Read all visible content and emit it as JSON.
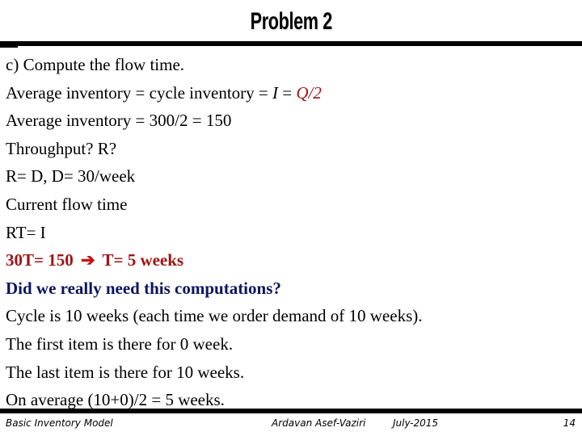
{
  "slide": {
    "title": "Problem 2",
    "lines": [
      {
        "text": "c) Compute the flow time."
      },
      {
        "prefix": "Average inventory = cycle inventory =  ",
        "var": "I",
        "eq": " = ",
        "formula": "Q/2"
      },
      {
        "text": "Average inventory  = 300/2 = 150"
      },
      {
        "text": "Throughput?  R?"
      },
      {
        "text": "R= D,  D= 30/week"
      },
      {
        "text": "Current flow time"
      },
      {
        "text": "RT= I"
      },
      {
        "left": "30T= 150",
        "arrow_icon": "right-arrow-icon",
        "arrow_glyph": "➔",
        "right": "T= 5 weeks"
      },
      {
        "text": "Did we really need this computations?"
      },
      {
        "text": "Cycle is 10 weeks (each time we order demand of 10 weeks)."
      },
      {
        "text": "The first item is there for 0 week."
      },
      {
        "text": "The last item is there for 10 weeks."
      },
      {
        "text": "On average (10+0)/2 = 5 weeks."
      }
    ]
  },
  "footer": {
    "left": "Basic Inventory Model",
    "author": "Ardavan Asef-Vaziri",
    "date": "July-2015",
    "page": "14"
  },
  "colors": {
    "highlight_red": "#a01414",
    "question_navy": "#0d1560",
    "text": "#000000"
  }
}
